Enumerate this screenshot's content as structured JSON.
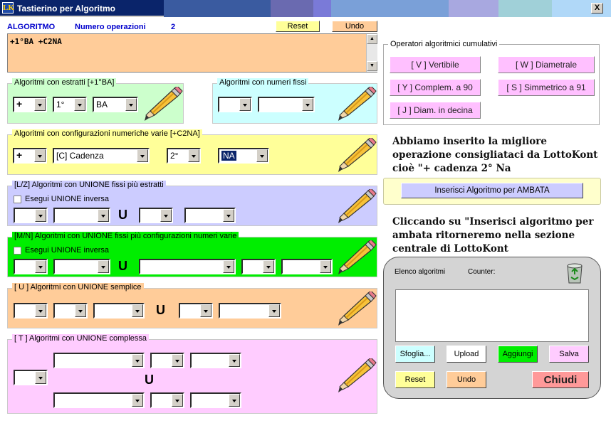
{
  "window": {
    "title": "Tastierino per Algoritmo",
    "close_label": "X",
    "logo_label": "LK"
  },
  "colors": {
    "titlebar": "#0a246a",
    "green_panel": "#ccffcc",
    "cyan_panel": "#ccffff",
    "yellow_panel": "#ffff99",
    "lavender_panel": "#ccccff",
    "bright_green_panel": "#00ee00",
    "peach_panel": "#ffcc99",
    "pink_panel": "#ffccff"
  },
  "header": {
    "algoritmo_label": "ALGORITMO",
    "num_ops_label": "Numero operazioni",
    "num_ops_value": "2",
    "reset_label": "Reset",
    "undo_label": "Undo"
  },
  "expression": {
    "value": "+1°BA +C2NA"
  },
  "panels": {
    "estratti": {
      "title": "Algoritmi con estratti  [+1°BA]",
      "sign": "+",
      "pos": "1°",
      "wheel": "BA"
    },
    "fissi": {
      "title": "Algoritmi con numeri fissi",
      "a": "",
      "b": ""
    },
    "config": {
      "title": "Algoritmi con configurazioni numeriche varie  [+C2NA]",
      "sign": "+",
      "config": "[C] Cadenza",
      "pos": "2°",
      "wheel": "NA"
    },
    "lz": {
      "title": "[L/Z] Algoritmi con UNIONE fissi più estratti",
      "check_label": "Esegui UNIONE inversa",
      "u": "U"
    },
    "mn": {
      "title": "[M/N] Algoritmi con UNIONE fissi più configurazioni numeri varie",
      "check_label": "Esegui UNIONE inversa",
      "u": "U"
    },
    "u": {
      "title": "[ U ] Algoritmi con UNIONE semplice",
      "u": "U"
    },
    "t": {
      "title": "[ T ] Algoritmi con UNIONE complessa",
      "u": "U"
    }
  },
  "operators": {
    "title": "Operatori algoritmici cumulativi",
    "buttons": [
      "[ V ] Vertibile",
      "[ W ] Diametrale",
      "[ Y ] Complem. a 90",
      "[ S ] Simmetrico  a 91",
      "[ J ] Diam. in decina"
    ]
  },
  "message1": "Abbiamo inserito la migliore operazione consigliataci da LottoKont  cioè \"+ cadenza 2° Na",
  "insert_button": "Inserisci Algoritmo per AMBATA",
  "message2": "Cliccando su \"Inserisci algoritmo per ambata ritorneremo nella sezione centrale di LottoKont",
  "list_panel": {
    "elenco_label": "Elenco algoritmi",
    "counter_label": "Counter:",
    "sfoglia": "Sfoglia...",
    "upload": "Upload",
    "aggiungi": "Aggiungi",
    "salva": "Salva",
    "reset": "Reset",
    "undo": "Undo",
    "chiudi": "Chiudi",
    "recycle_icon": "recycle-bin-icon"
  }
}
